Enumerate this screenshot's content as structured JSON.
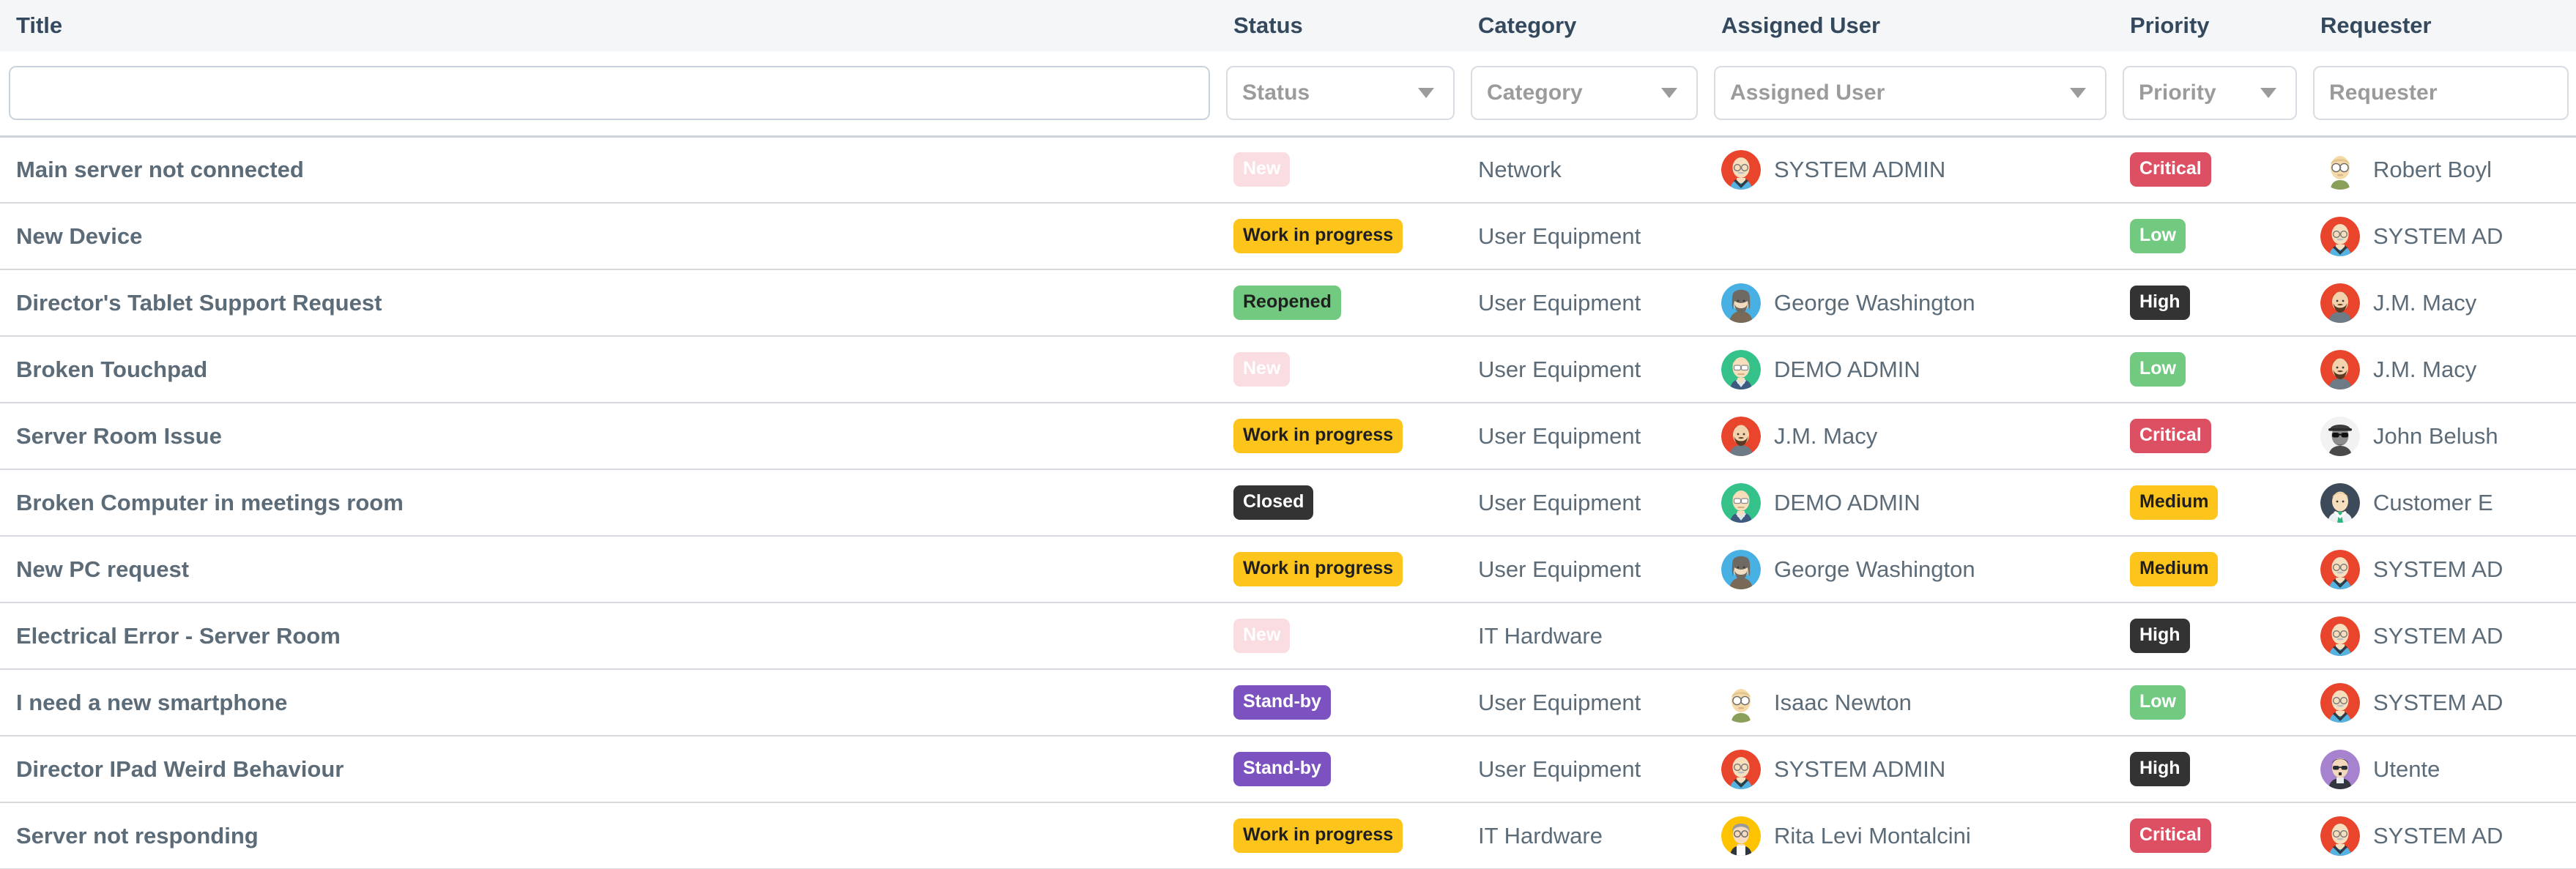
{
  "table": {
    "columns": [
      {
        "key": "title",
        "label": "Title"
      },
      {
        "key": "status",
        "label": "Status"
      },
      {
        "key": "category",
        "label": "Category"
      },
      {
        "key": "assigned",
        "label": "Assigned User"
      },
      {
        "key": "priority",
        "label": "Priority"
      },
      {
        "key": "requester",
        "label": "Requester"
      }
    ],
    "filters": {
      "title": {
        "type": "text",
        "value": "",
        "placeholder": ""
      },
      "status": {
        "type": "select",
        "value": "Status"
      },
      "category": {
        "type": "select",
        "value": "Category"
      },
      "assigned": {
        "type": "select",
        "value": "Assigned User"
      },
      "priority": {
        "type": "select",
        "value": "Priority"
      },
      "requester": {
        "type": "select",
        "value": "Requester"
      }
    },
    "rows": [
      {
        "title": "Main server not connected",
        "status": "New",
        "status_variant": "new",
        "category": "Network",
        "assigned": "SYSTEM ADMIN",
        "assigned_avatar": "system-admin",
        "priority": "Critical",
        "priority_variant": "critical",
        "requester": "Robert Boyl",
        "requester_avatar": "robert-boyle"
      },
      {
        "title": "New Device",
        "status": "Work in progress",
        "status_variant": "wip",
        "category": "User Equipment",
        "assigned": "",
        "assigned_avatar": "",
        "priority": "Low",
        "priority_variant": "low",
        "requester": "SYSTEM AD",
        "requester_avatar": "system-admin"
      },
      {
        "title": "Director's Tablet Support Request",
        "status": "Reopened",
        "status_variant": "reopened",
        "category": "User Equipment",
        "assigned": "George Washington",
        "assigned_avatar": "george-washington",
        "priority": "High",
        "priority_variant": "high",
        "requester": "J.M. Macy",
        "requester_avatar": "jm-macy"
      },
      {
        "title": "Broken Touchpad",
        "status": "New",
        "status_variant": "new",
        "category": "User Equipment",
        "assigned": "DEMO ADMIN",
        "assigned_avatar": "demo-admin",
        "priority": "Low",
        "priority_variant": "low",
        "requester": "J.M. Macy",
        "requester_avatar": "jm-macy"
      },
      {
        "title": "Server Room Issue",
        "status": "Work in progress",
        "status_variant": "wip",
        "category": "User Equipment",
        "assigned": "J.M. Macy",
        "assigned_avatar": "jm-macy",
        "priority": "Critical",
        "priority_variant": "critical",
        "requester": "John Belush",
        "requester_avatar": "john-belushi"
      },
      {
        "title": "Broken Computer in meetings room",
        "status": "Closed",
        "status_variant": "closed",
        "category": "User Equipment",
        "assigned": "DEMO ADMIN",
        "assigned_avatar": "demo-admin",
        "priority": "Medium",
        "priority_variant": "medium",
        "requester": "Customer E",
        "requester_avatar": "customer"
      },
      {
        "title": "New PC request",
        "status": "Work in progress",
        "status_variant": "wip",
        "category": "User Equipment",
        "assigned": "George Washington",
        "assigned_avatar": "george-washington",
        "priority": "Medium",
        "priority_variant": "medium",
        "requester": "SYSTEM AD",
        "requester_avatar": "system-admin"
      },
      {
        "title": "Electrical Error - Server Room",
        "status": "New",
        "status_variant": "new",
        "category": "IT Hardware",
        "assigned": "",
        "assigned_avatar": "",
        "priority": "High",
        "priority_variant": "high",
        "requester": "SYSTEM AD",
        "requester_avatar": "system-admin"
      },
      {
        "title": "I need a new smartphone",
        "status": "Stand-by",
        "status_variant": "standby",
        "category": "User Equipment",
        "assigned": "Isaac Newton",
        "assigned_avatar": "isaac-newton",
        "priority": "Low",
        "priority_variant": "low",
        "requester": "SYSTEM AD",
        "requester_avatar": "system-admin"
      },
      {
        "title": "Director IPad Weird Behaviour",
        "status": "Stand-by",
        "status_variant": "standby",
        "category": "User Equipment",
        "assigned": "SYSTEM ADMIN",
        "assigned_avatar": "system-admin",
        "priority": "High",
        "priority_variant": "high",
        "requester": "Utente",
        "requester_avatar": "utente"
      },
      {
        "title": "Server not responding",
        "status": "Work in progress",
        "status_variant": "wip",
        "category": "IT Hardware",
        "assigned": "Rita Levi Montalcini",
        "assigned_avatar": "rita-levi",
        "priority": "Critical",
        "priority_variant": "critical",
        "requester": "SYSTEM AD",
        "requester_avatar": "system-admin"
      }
    ]
  },
  "colors": {
    "header_bg": "#f5f6f7",
    "header_text": "#34495e",
    "row_text": "#5c6b78",
    "row_border": "#d6d9dd",
    "status_new": "#fadde1",
    "status_wip": "#fdc41b",
    "status_reopened": "#72c980",
    "status_closed": "#333333",
    "status_standby": "#7b52c0",
    "priority_critical": "#dd4f62",
    "priority_low": "#72c980",
    "priority_high": "#333333",
    "priority_medium": "#fdc41b"
  }
}
